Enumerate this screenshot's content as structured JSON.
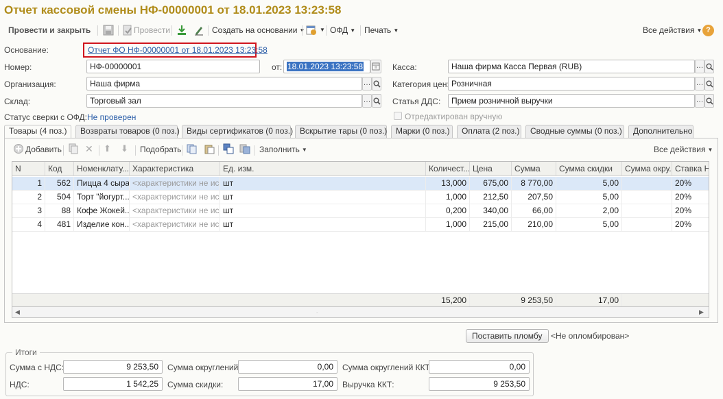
{
  "title": "Отчет кассовой смены НФ-00000001 от 18.01.2023 13:23:58",
  "toolbar": {
    "post_close": "Провести и закрыть",
    "post": "Провести",
    "create_based": "Создать на основании",
    "ofd": "ОФД",
    "print": "Печать",
    "all_actions": "Все действия",
    "help": "?"
  },
  "form": {
    "basis_label": "Основание:",
    "basis_value": "Отчет ФО НФ-00000001 от 18.01.2023 13:23:58",
    "number_label": "Номер:",
    "number_value": "НФ-00000001",
    "date_label": "от:",
    "date_value": "18.01.2023 13:23:58",
    "kassa_label": "Касса:",
    "kassa_value": "Наша фирма Касса Первая (RUB)",
    "org_label": "Организация:",
    "org_value": "Наша фирма",
    "price_cat_label": "Категория цен:",
    "price_cat_value": "Розничная",
    "warehouse_label": "Склад:",
    "warehouse_value": "Торговый зал",
    "dds_label": "Статья ДДС:",
    "dds_value": "Прием розничной выручки",
    "ofd_status_label": "Статус сверки с ОФД:",
    "ofd_status_value": "Не проверен",
    "edited_manually": "Отредактирован вручную"
  },
  "tabs": [
    "Товары (4 поз.)",
    "Возвраты товаров (0 поз.)",
    "Виды сертификатов (0 поз.)",
    "Вскрытие тары (0 поз.)",
    "Марки (0 поз.)",
    "Оплата (2 поз.)",
    "Сводные суммы (0 поз.)",
    "Дополнительно"
  ],
  "grid_toolbar": {
    "add": "Добавить",
    "pick": "Подобрать",
    "fill": "Заполнить",
    "all_actions": "Все действия"
  },
  "table": {
    "columns": [
      "N",
      "Код",
      "Номенклату...",
      "Характеристика",
      "Ед. изм.",
      "Количест...",
      "Цена",
      "Сумма",
      "Сумма скидки",
      "Сумма окру...",
      "Ставка Н..."
    ],
    "rows": [
      [
        "1",
        "562",
        "Пицца 4 сыра",
        "<характеристики не ис...",
        "шт",
        "13,000",
        "675,00",
        "8 770,00",
        "5,00",
        "",
        "20%"
      ],
      [
        "2",
        "504",
        "Торт \"йогурт...",
        "<характеристики не ис...",
        "шт",
        "1,000",
        "212,50",
        "207,50",
        "5,00",
        "",
        "20%"
      ],
      [
        "3",
        "88",
        "Кофе Жокей...",
        "<характеристики не ис...",
        "шт",
        "0,200",
        "340,00",
        "66,00",
        "2,00",
        "",
        "20%"
      ],
      [
        "4",
        "481",
        "Изделие кон...",
        "<характеристики не ис...",
        "шт",
        "1,000",
        "215,00",
        "210,00",
        "5,00",
        "",
        "20%"
      ]
    ],
    "footer": {
      "qty": "15,200",
      "sum": "9 253,50",
      "discount": "17,00"
    }
  },
  "seal": {
    "button": "Поставить пломбу",
    "status": "<Не опломбирован>"
  },
  "totals": {
    "title": "Итоги",
    "sum_vat_label": "Сумма с НДС:",
    "sum_vat": "9 253,50",
    "rounding_label": "Сумма округлений:",
    "rounding": "0,00",
    "rounding_kkt_label": "Сумма округлений ККТ:",
    "rounding_kkt": "0,00",
    "vat_label": "НДС:",
    "vat": "1 542,25",
    "discount_label": "Сумма скидки:",
    "discount": "17,00",
    "revenue_kkt_label": "Выручка ККТ:",
    "revenue_kkt": "9 253,50"
  },
  "colors": {
    "title": "#b08c1a",
    "selected_row": "#dbe8f8",
    "link": "#2a5da8",
    "highlight_box": "#d0141c"
  }
}
